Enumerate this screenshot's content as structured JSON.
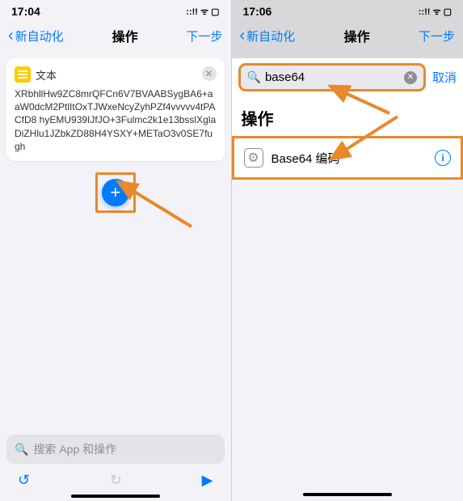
{
  "left": {
    "status": {
      "time": "17:04",
      "icons": "::!! ᯤ ▢"
    },
    "nav": {
      "back": "新自动化",
      "title": "操作",
      "next": "下一步"
    },
    "card": {
      "label": "文本",
      "body": "XRbhllHw9ZC8mrQFCn6V7BVAABSygBA6+aaW0dcM2PtlItOxTJWxeNcyZyhPZf4vvvvv4tPACfD8\nhyEMU939IJfJO+3Fulmc2k1e13bsslXglaDiZHlu1JZbkZD88H4YSXY+METaO3v0SE7fugh"
    },
    "search": {
      "placeholder": "搜索 App 和操作"
    }
  },
  "right": {
    "status": {
      "time": "17:06",
      "icons": "::!! ᯤ ▢"
    },
    "nav": {
      "back": "新自动化",
      "title": "操作",
      "next": "下一步"
    },
    "search": {
      "value": "base64",
      "cancel": "取消"
    },
    "section": "操作",
    "result": {
      "label": "Base64 编码"
    }
  }
}
